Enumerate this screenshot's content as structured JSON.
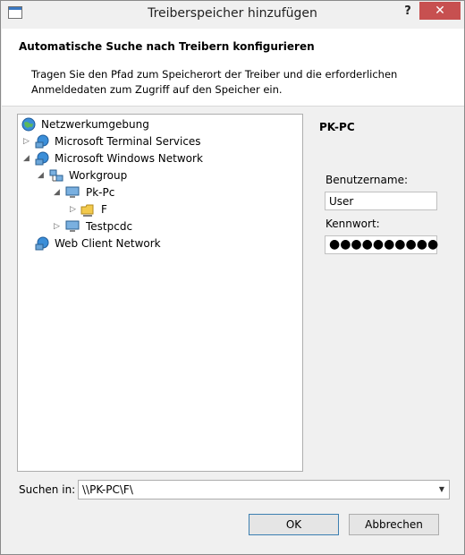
{
  "window": {
    "title": "Treiberspeicher hinzufügen",
    "help_label": "?",
    "close_label": "✕"
  },
  "header": {
    "title": "Automatische Suche nach Treibern konfigurieren",
    "description": "Tragen Sie den Pfad zum Speicherort der Treiber und die erforderlichen Anmeldedaten zum Zugriff auf den Speicher ein."
  },
  "tree": {
    "items": [
      {
        "label": "Netzwerkumgebung",
        "icon": "network-globe-icon",
        "expander": ""
      },
      {
        "label": "Microsoft Terminal Services",
        "icon": "network-globe-icon",
        "expander": "▷"
      },
      {
        "label": "Microsoft Windows Network",
        "icon": "network-globe-icon",
        "expander": "◢"
      },
      {
        "label": "Workgroup",
        "icon": "workgroup-icon",
        "expander": "◢"
      },
      {
        "label": "Pk-Pc",
        "icon": "computer-icon",
        "expander": "◢"
      },
      {
        "label": "F",
        "icon": "shared-folder-icon",
        "expander": "▷",
        "selected": true
      },
      {
        "label": "Testpcdc",
        "icon": "computer-icon",
        "expander": "▷"
      },
      {
        "label": "Web Client Network",
        "icon": "network-globe-icon",
        "expander": ""
      }
    ]
  },
  "credentials": {
    "computer": "PK-PC",
    "username_label": "Benutzername:",
    "username_value": "User",
    "password_label": "Kennwort:",
    "password_value": "●●●●●●●●●●"
  },
  "search": {
    "label": "Suchen in:",
    "value": "\\\\PK-PC\\F\\",
    "dropdown_glyph": "▼"
  },
  "buttons": {
    "ok": "OK",
    "cancel": "Abbrechen"
  }
}
